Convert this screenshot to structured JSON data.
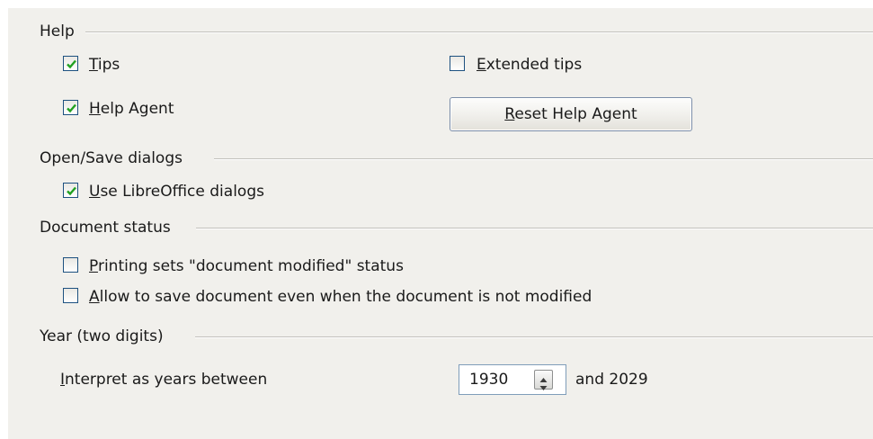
{
  "help": {
    "title": "Help",
    "tips": {
      "pre": "",
      "accel": "T",
      "post": "ips",
      "checked": true
    },
    "help_agent": {
      "pre": "",
      "accel": "H",
      "post": "elp Agent",
      "checked": true
    },
    "extended_tips": {
      "pre": "",
      "accel": "E",
      "post": "xtended tips",
      "checked": false
    },
    "reset_button": {
      "pre": "",
      "accel": "R",
      "post": "eset Help Agent"
    }
  },
  "open_save": {
    "title": "Open/Save dialogs",
    "use_dialogs": {
      "pre": "",
      "accel": "U",
      "post": "se LibreOffice dialogs",
      "checked": true
    }
  },
  "doc_status": {
    "title": "Document status",
    "printing": {
      "pre": "",
      "accel": "P",
      "post": "rinting sets \"document modified\" status",
      "checked": false
    },
    "allow_save": {
      "pre": "",
      "accel": "A",
      "post": "llow to save document even when the document is not modified",
      "checked": false
    }
  },
  "year": {
    "title": "Year (two digits)",
    "interpret": {
      "pre": "",
      "accel": "I",
      "post": "nterpret as years between"
    },
    "start_year": "1930",
    "and_label": "and 2029"
  },
  "icons": {
    "checkmark": "checkmark-icon",
    "spin": "spin-arrows-icon"
  },
  "colors": {
    "panel": "#f1f0ec",
    "check": "#21a121",
    "checkbox_border": "#1d5180"
  }
}
